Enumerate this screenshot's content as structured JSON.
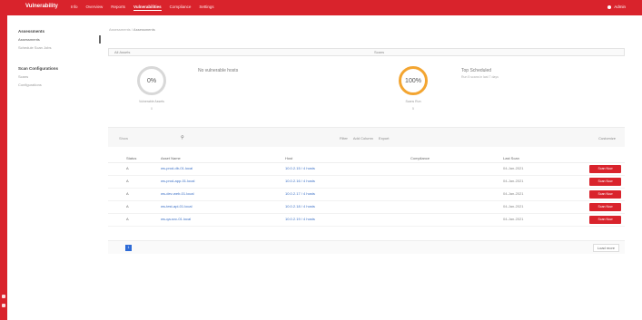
{
  "header": {
    "brand": "Vulnerability",
    "nav": [
      "Info",
      "Overview",
      "Reports",
      "Vulnerabilities",
      "Compliance",
      "Settings"
    ],
    "active_nav": "Vulnerabilities",
    "user": "Admin"
  },
  "sidebar": {
    "groups": [
      {
        "title": "Assessments",
        "items": [
          "Assessments",
          "Schedule Scan Jobs"
        ]
      },
      {
        "title": "Scan Configurations",
        "items": [
          "Scans",
          "Configurations"
        ]
      }
    ]
  },
  "breadcrumb": {
    "parent": "Assessments",
    "current": "Assessments"
  },
  "filters": {
    "left": "All Assets",
    "right": "Scans"
  },
  "gauges": {
    "g1": {
      "value": "0%",
      "label": "Vulnerable Assets",
      "sub": "0",
      "title": "No vulnerable hosts",
      "desc": "",
      "level": 0
    },
    "g2": {
      "value": "100%",
      "label": "Scans Run",
      "sub": "5",
      "title": "Top Scheduled",
      "desc": "Run 5 scans in last 7 days",
      "level": 100
    }
  },
  "table_toolbar": {
    "rows_label": "Show",
    "search_icon": "search-icon",
    "actions": [
      "Filter",
      "Add Column",
      "Export"
    ],
    "right_label": "Customize"
  },
  "table": {
    "columns": [
      "Status",
      "Asset Name",
      "Host",
      "Compliance",
      "Last Scan",
      ""
    ],
    "rows": [
      {
        "status": "A",
        "name": "ws-prod-db-01.local",
        "host": "10.0.2.15 / 4 hosts",
        "compliance": "",
        "date": "04-Jan-2021",
        "action": "Scan Now"
      },
      {
        "status": "A",
        "name": "ws-prod-app-01.local",
        "host": "10.0.2.16 / 4 hosts",
        "compliance": "",
        "date": "04-Jan-2021",
        "action": "Scan Now"
      },
      {
        "status": "A",
        "name": "ws-dev-web-01.local",
        "host": "10.0.2.17 / 4 hosts",
        "compliance": "",
        "date": "04-Jan-2021",
        "action": "Scan Now"
      },
      {
        "status": "A",
        "name": "ws-test-api-01.local",
        "host": "10.0.2.18 / 4 hosts",
        "compliance": "",
        "date": "04-Jan-2021",
        "action": "Scan Now"
      },
      {
        "status": "A",
        "name": "ws-qa-svc-01.local",
        "host": "10.0.2.19 / 4 hosts",
        "compliance": "",
        "date": "04-Jan-2021",
        "action": "Scan Now"
      }
    ]
  },
  "pager": {
    "current_page": "1",
    "more_label": "Load more"
  },
  "colors": {
    "brand_red": "#d9232c",
    "gauge_orange": "#f3a531",
    "link_blue": "#3a6fc6",
    "page_blue": "#2e6bd6"
  }
}
